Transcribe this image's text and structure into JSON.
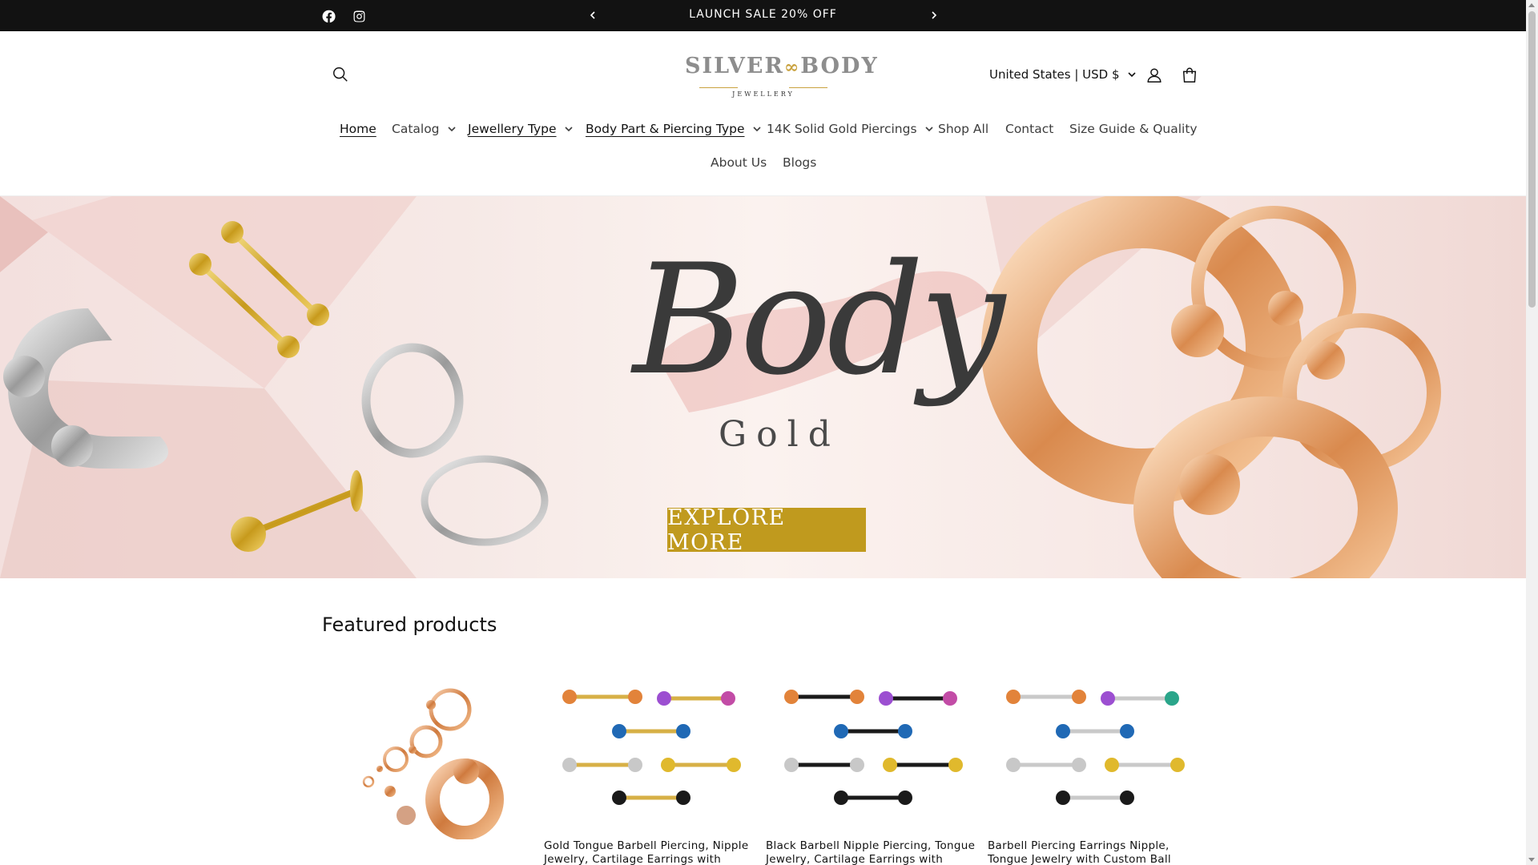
{
  "announcement": {
    "text": "LAUNCH SALE 20% OFF",
    "social": [
      "facebook-icon",
      "instagram-icon"
    ]
  },
  "header": {
    "logo": {
      "word1": "SILVER",
      "word2": "BODY",
      "sub": "JEWELLERY"
    },
    "currency": "United States | USD $"
  },
  "nav": {
    "items": [
      {
        "label": "Home",
        "dropdown": false
      },
      {
        "label": "Catalog",
        "dropdown": true
      },
      {
        "label": "Jewellery Type",
        "dropdown": true
      },
      {
        "label": "Body Part & Piercing Type",
        "dropdown": true
      },
      {
        "label": "14K Solid Gold Piercings",
        "dropdown": true
      },
      {
        "label": "Shop All",
        "dropdown": false
      },
      {
        "label": "Contact",
        "dropdown": false
      },
      {
        "label": "Size Guide & Quality",
        "dropdown": false
      },
      {
        "label": "About Us",
        "dropdown": false
      },
      {
        "label": "Blogs",
        "dropdown": false
      }
    ]
  },
  "hero": {
    "script_text": "Body",
    "sub_text": "Gold",
    "button_label": "EXPLORE MORE"
  },
  "featured": {
    "title": "Featured products",
    "products": [
      {
        "title": ""
      },
      {
        "title": "Gold Tongue Barbell Piercing, Nipple Jewelry, Cartilage Earrings with Custom"
      },
      {
        "title": "Black Barbell Nipple Piercing, Tongue Jewelry, Cartilage Earrings with Custom"
      },
      {
        "title": "Barbell Piercing Earrings Nipple, Tongue Jewelry with Custom Ball"
      }
    ]
  },
  "colors": {
    "announcement_bg": "#121212",
    "button_gold": "#c09a1e",
    "hero_pink": "#f3e0de"
  }
}
